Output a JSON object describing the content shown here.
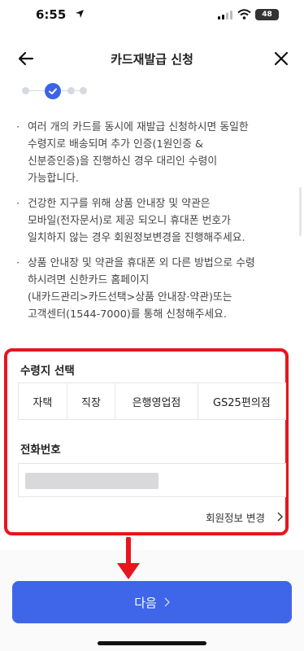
{
  "status_bar": {
    "time": "6:55",
    "battery": "48"
  },
  "header": {
    "title": "카드재발급 신청"
  },
  "notices": [
    {
      "bullet": "·",
      "text": "여러 개의 카드를 동시에 재발급 신청하시면 동일한\n수령지로 배송되며 추가 인증(1원인증 &\n신분증인증)을 진행하신 경우 대리인 수령이\n가능합니다."
    },
    {
      "bullet": "·",
      "text": "건강한 지구를 위해 상품 안내장 및 약관은\n모바일(전자문서)로 제공 되오니 휴대폰 번호가\n일치하지 않는 경우 회원정보변경을 진행해주세요."
    },
    {
      "bullet": "·",
      "text": "상품 안내장 및 약관을 휴대폰 외 다른 방법으로 수령\n하시려면 신한카드 홈페이지\n(내카드관리>카드선택>상품 안내장·약관)또는\n고객센터(1544-7000)를 통해 신청해주세요."
    }
  ],
  "form": {
    "receipt_label": "수령지 선택",
    "receipt_options": [
      "자택",
      "직장",
      "은행영업점",
      "GS25편의점"
    ],
    "phone_label": "전화번호",
    "member_info_link": "회원정보 변경"
  },
  "next_button": {
    "label": "다음"
  },
  "colors": {
    "accent": "#3f66e8",
    "highlight": "#e8141e"
  }
}
